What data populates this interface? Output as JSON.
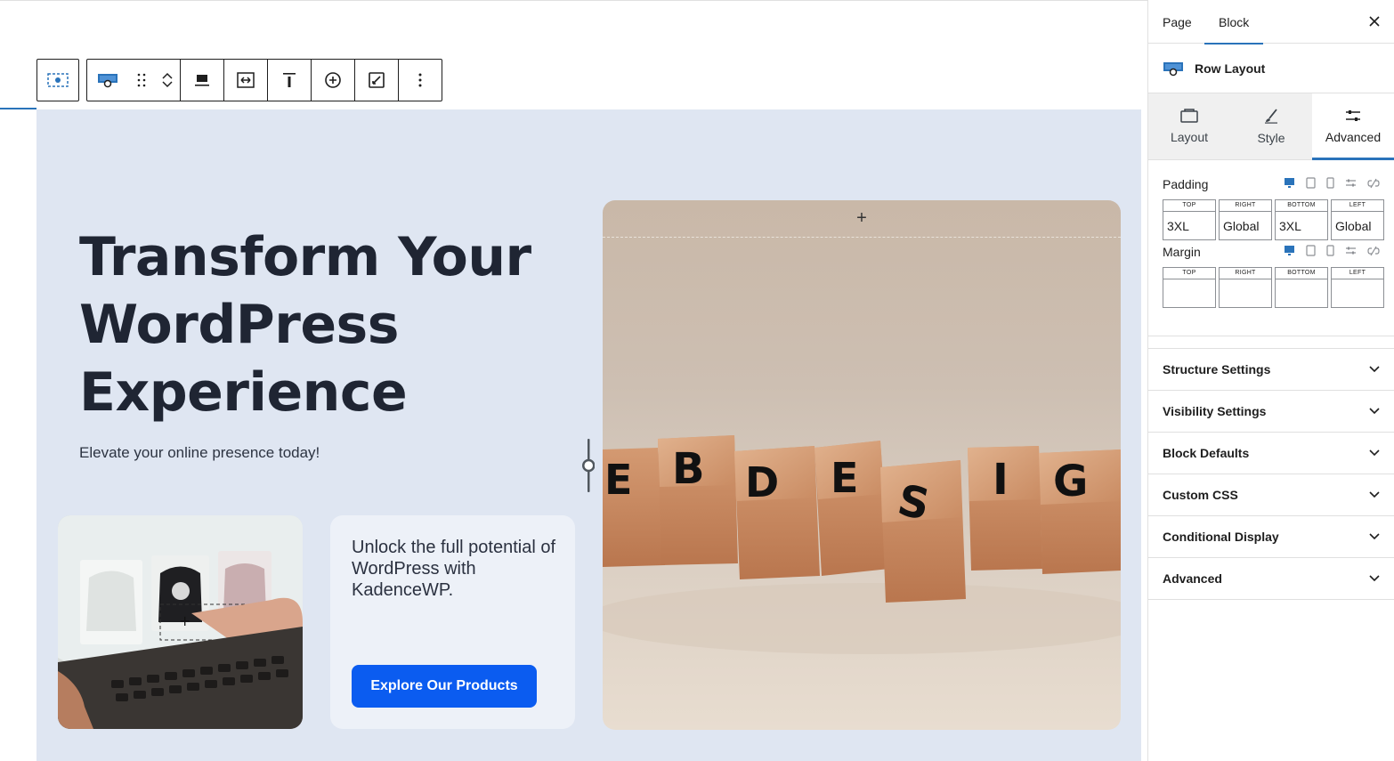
{
  "toolbar": {
    "parent_icon": "row-layout-icon",
    "block_icon": "row-layout-icon",
    "buttons": [
      "drag-handle-icon",
      "move-up-icon",
      "move-down-icon",
      "align-icon",
      "width-icon",
      "vertical-align-icon",
      "add-icon",
      "edit-icon",
      "more-options-icon"
    ]
  },
  "canvas": {
    "hero_title": "Transform Your WordPress Experience",
    "hero_subtitle": "Elevate your online presence today!",
    "card_text": "Unlock the full potential of WordPress with KadenceWP.",
    "cta_label": "Explore Our Products",
    "image_add_label": "+",
    "colors": {
      "row_bg": "#dfe6f2",
      "card_bg": "#edf1f8",
      "cta_bg": "#0b5cf0",
      "title": "#1f2533"
    }
  },
  "sidebar": {
    "tabs": [
      "Page",
      "Block"
    ],
    "active_tab": "Block",
    "block_name": "Row Layout",
    "subtabs": [
      {
        "label": "Layout",
        "icon": "layout-icon"
      },
      {
        "label": "Style",
        "icon": "brush-icon"
      },
      {
        "label": "Advanced",
        "icon": "sliders-icon"
      }
    ],
    "active_subtab": "Advanced",
    "padding": {
      "label": "Padding",
      "sides": [
        "TOP",
        "RIGHT",
        "BOTTOM",
        "LEFT"
      ],
      "values": [
        "3XL",
        "Global",
        "3XL",
        "Global"
      ]
    },
    "margin": {
      "label": "Margin",
      "sides": [
        "TOP",
        "RIGHT",
        "BOTTOM",
        "LEFT"
      ],
      "values": [
        "",
        "",
        "",
        ""
      ]
    },
    "panels": [
      "Structure Settings",
      "Visibility Settings",
      "Block Defaults",
      "Custom CSS",
      "Conditional Display",
      "Advanced"
    ],
    "accent": "#2a73ba"
  }
}
